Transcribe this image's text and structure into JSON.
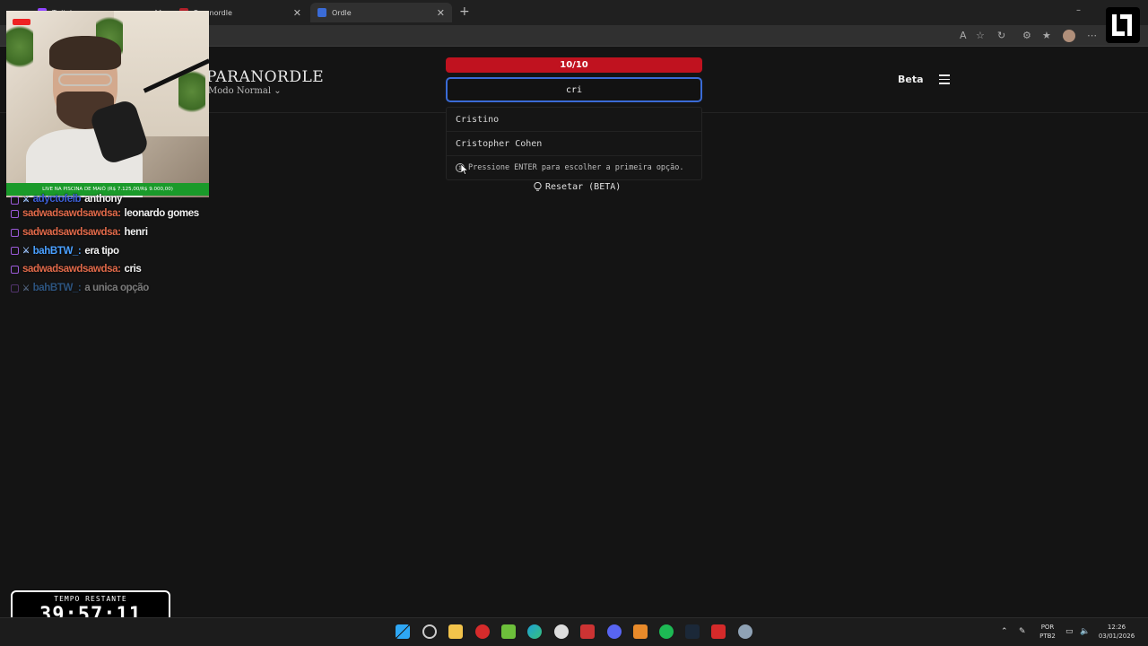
{
  "browser": {
    "tabs": [
      {
        "label": "Twitch",
        "color": "#9146ff"
      },
      {
        "label": "Paranordle",
        "color": "#b0202a"
      },
      {
        "label": "Ordle",
        "color": "#3a6bd6"
      }
    ],
    "new_tab_symbol": "+",
    "window_controls": [
      "–",
      "❐",
      "✕"
    ]
  },
  "site": {
    "logo": "PARANORDLE",
    "mode_label": "Modo Normal",
    "beta_label": "Beta",
    "attempts": "10/10",
    "search": {
      "value": "cri",
      "placeholder": ""
    },
    "suggestions": [
      "Cristino",
      "Cristopher Cohen"
    ],
    "hint": "Pressione ENTER para escolher a primeira opção.",
    "reset_label": "Resetar (BETA)",
    "accent": "#c0121f",
    "focus_color": "#3a6bd6"
  },
  "stream": {
    "live_bar": "LIVE NA PISCINA DE MAIÓ (R$ 7.125,00/R$ 9.000,00)",
    "chat": [
      {
        "user": "adyctofelb",
        "message": "anthony",
        "user_color": "#3c5fd6",
        "sword": true
      },
      {
        "user": "sadwadsawdsawdsa:",
        "message": "leonardo gomes",
        "user_color": "#e26a4a",
        "sword": false
      },
      {
        "user": "sadwadsawdsawdsa:",
        "message": "henri",
        "user_color": "#e26a4a",
        "sword": false
      },
      {
        "user": "bahBTW_:",
        "message": "era tipo",
        "user_color": "#4aa0ff",
        "sword": true
      },
      {
        "user": "sadwadsawdsawdsa:",
        "message": "cris",
        "user_color": "#e26a4a",
        "sword": false
      },
      {
        "user": "bahBTW_:",
        "message": "a unica opção",
        "user_color": "#4aa0ff",
        "sword": true
      }
    ],
    "timer_label": "TEMPO RESTANTE",
    "timer_value": "39:57:11"
  },
  "taskbar": {
    "language": "POR",
    "layout": "PTB2",
    "time": "12:26",
    "date": "03/01/2026",
    "apps": [
      "windows-start",
      "clock",
      "file-explorer",
      "record",
      "text-editor",
      "edge",
      "mascot",
      "news",
      "discord",
      "tools",
      "spotify",
      "steam",
      "flash",
      "settings"
    ]
  }
}
